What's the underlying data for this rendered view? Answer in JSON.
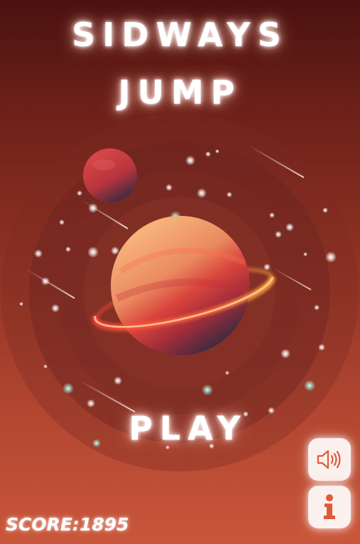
{
  "title": {
    "line1": "SIDWAYS",
    "line2": "JUMP"
  },
  "play_label": "PLAY",
  "score": {
    "label": "SCORE:",
    "value": "1895"
  },
  "buttons": {
    "sound_icon": "speaker-icon",
    "info_icon": "info-icon"
  },
  "colors": {
    "background_top": "#4a1210",
    "background_bottom": "#c9563a",
    "planet_main": "#f0a070",
    "planet_shadow": "#3a2a3e",
    "ring": "#ff5a3c",
    "small_planet": "#c23a3a",
    "glow": "#ffffff"
  }
}
